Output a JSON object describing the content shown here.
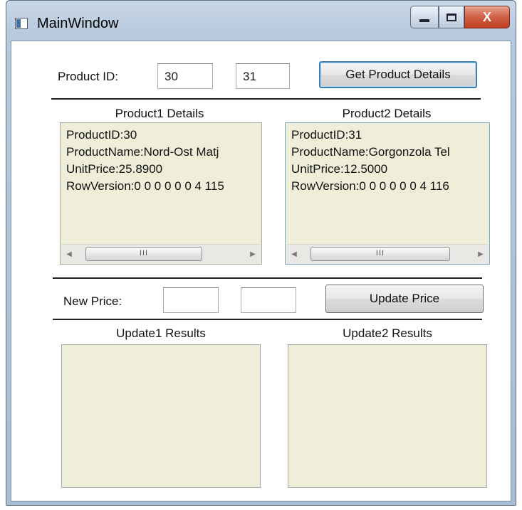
{
  "window": {
    "title": "MainWindow",
    "close_glyph": "X"
  },
  "product_id": {
    "label": "Product ID:",
    "id1": "30",
    "id2": "31",
    "button": "Get Product Details"
  },
  "product1": {
    "title": "Product1 Details",
    "lines": [
      "ProductID:30",
      "ProductName:Nord-Ost Matj",
      "UnitPrice:25.8900",
      "RowVersion:0 0 0 0 0 0 4 115"
    ]
  },
  "product2": {
    "title": "Product2 Details",
    "lines": [
      "ProductID:31",
      "ProductName:Gorgonzola Tel",
      "UnitPrice:12.5000",
      "RowVersion:0 0 0 0 0 0 4 116"
    ]
  },
  "scroll_thumb_grip": "III",
  "new_price": {
    "label": "New Price:",
    "price1": "",
    "price2": "",
    "button": "Update Price"
  },
  "update1": {
    "title": "Update1 Results"
  },
  "update2": {
    "title": "Update2 Results"
  },
  "icons": {
    "app": "window-app-icon",
    "minimize": "minimize-icon",
    "maximize": "maximize-icon",
    "close": "close-icon",
    "scroll_left": "scroll-left-arrow-icon",
    "scroll_right": "scroll-right-arrow-icon"
  },
  "colors": {
    "panel_background": "#efeed9",
    "close_button": "#c23e21",
    "focus_border": "#3c7fb1"
  }
}
